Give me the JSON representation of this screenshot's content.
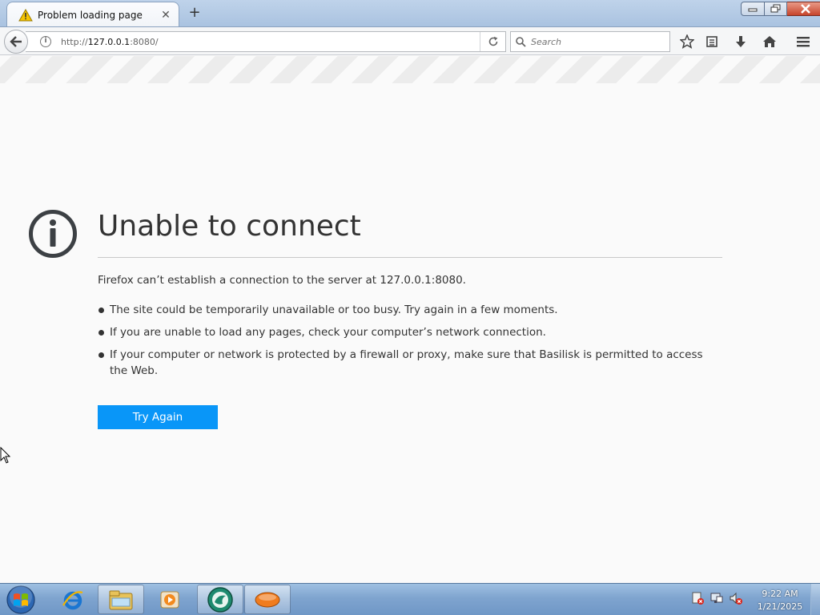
{
  "window": {
    "tab_title": "Problem loading page",
    "new_tab_symbol": "+",
    "close_tab_symbol": "✕"
  },
  "navbar": {
    "url_prefix": "http://",
    "url_host": "127.0.0.1",
    "url_suffix": ":8080/",
    "search_placeholder": "Search"
  },
  "error": {
    "title": "Unable to connect",
    "description": "Firefox can’t establish a connection to the server at 127.0.0.1:8080.",
    "bullets": [
      "The site could be temporarily unavailable or too busy. Try again in a few moments.",
      "If you are unable to load any pages, check your computer’s network connection.",
      "If your computer or network is protected by a firewall or proxy, make sure that Basilisk is permitted to access the Web."
    ],
    "button_label": "Try Again"
  },
  "taskbar": {
    "time": "9:22 AM",
    "date": "1/21/2025",
    "pinned": [
      "internet-explorer-icon",
      "file-explorer-icon",
      "media-player-icon",
      "basilisk-icon",
      "app-icon"
    ]
  },
  "colors": {
    "accent_button": "#0996f8",
    "text": "#333333"
  }
}
